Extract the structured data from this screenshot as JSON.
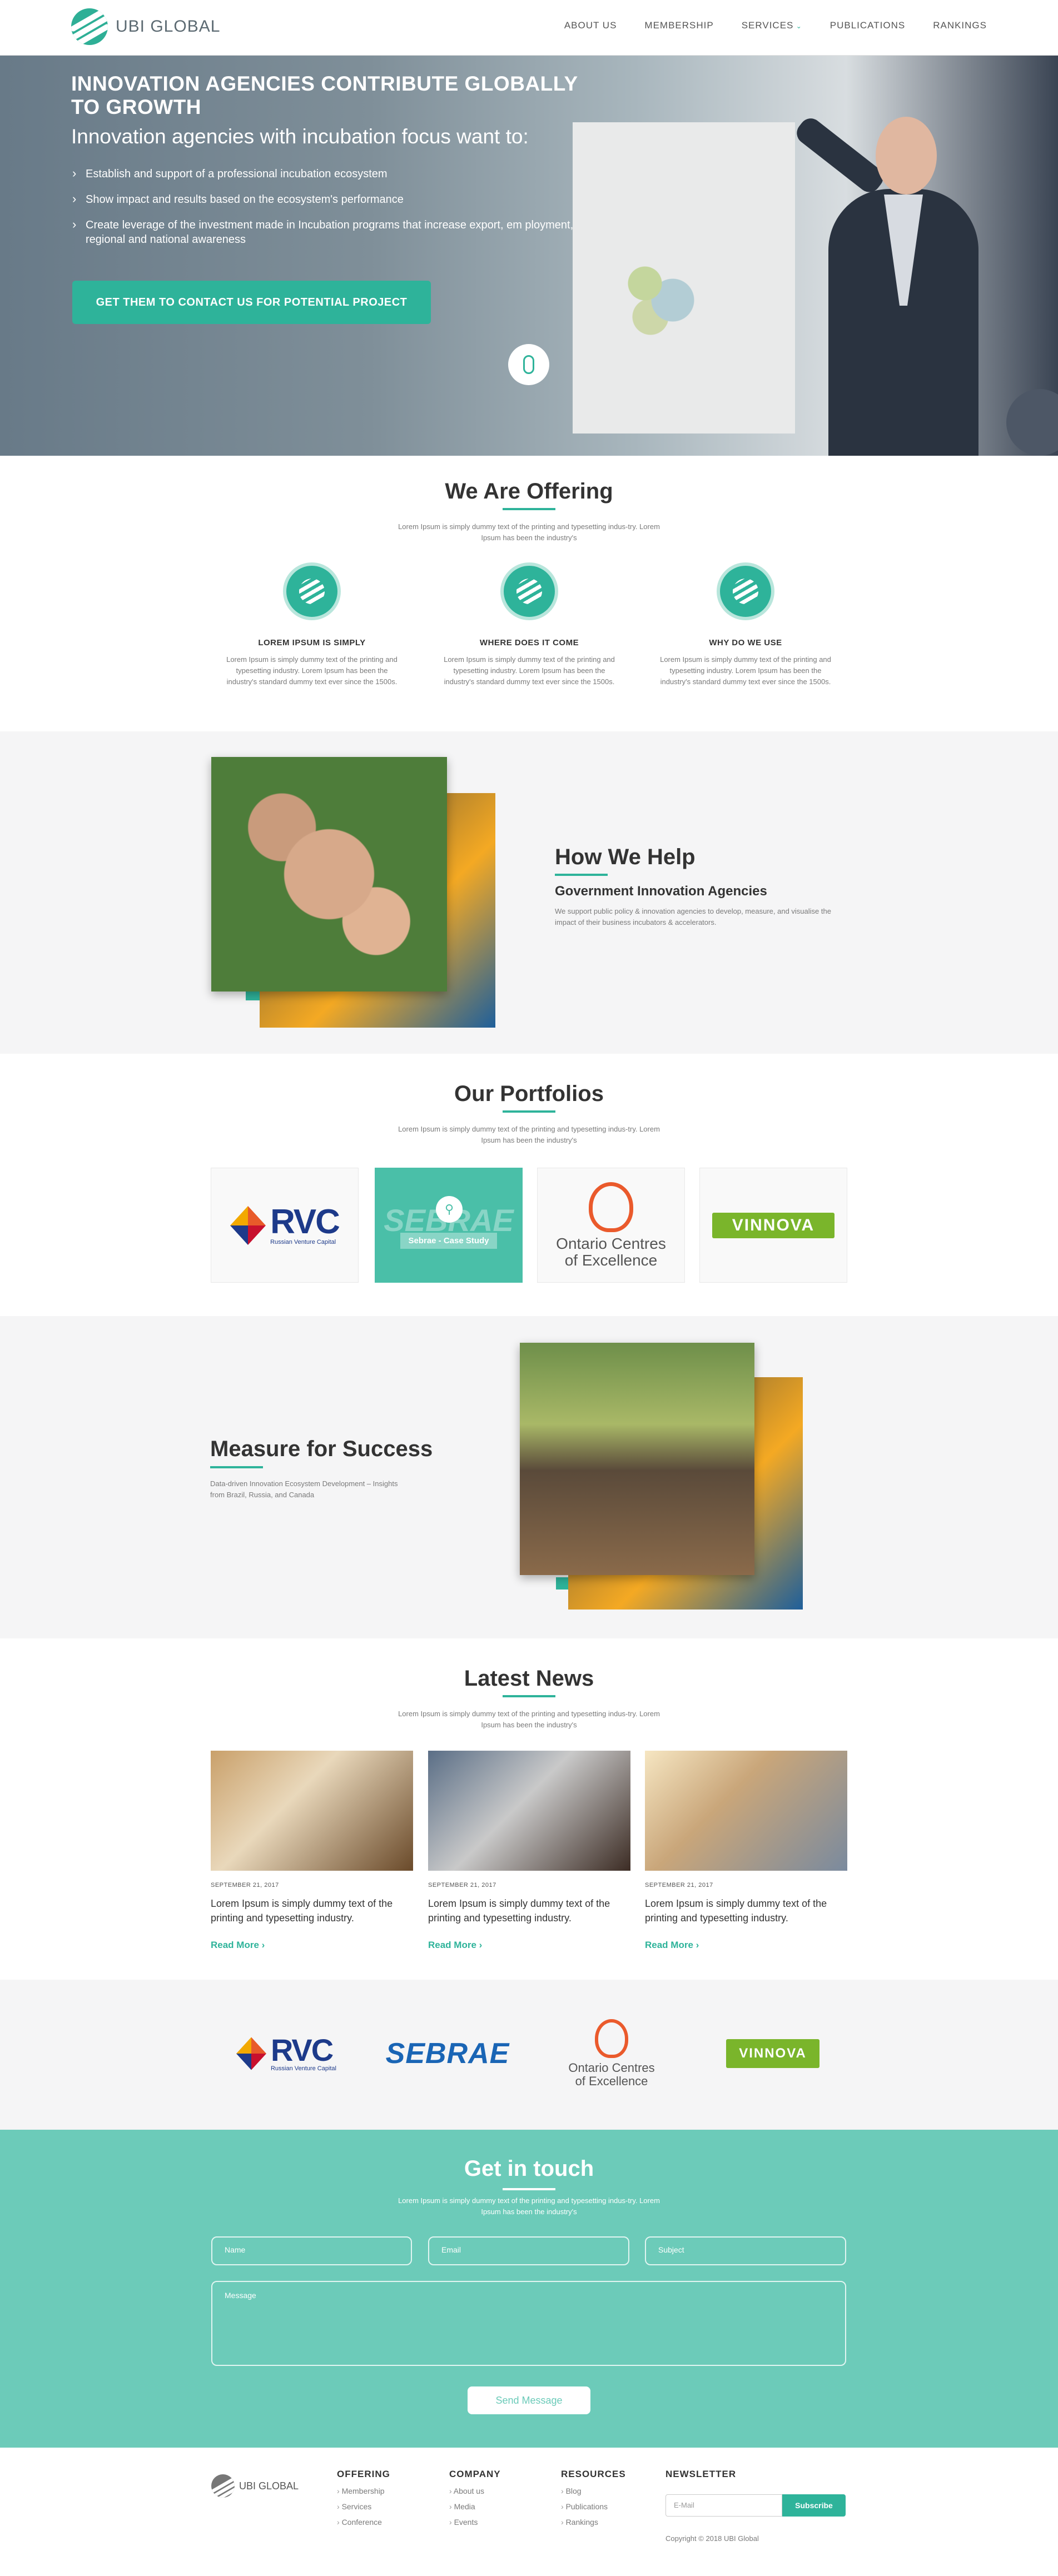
{
  "nav": {
    "logo_text": "UBI GLOBAL",
    "items": [
      "ABOUT US",
      "MEMBERSHIP",
      "SERVICES",
      "PUBLICATIONS",
      "RANKINGS"
    ]
  },
  "hero": {
    "title": "INNOVATION AGENCIES CONTRIBUTE GLOBALLY TO GROWTH",
    "subtitle": "Innovation agencies with incubation focus want to:",
    "bullets": [
      "Establish and support of a professional incubation ecosystem",
      "Show impact and results based on the ecosystem's performance",
      "Create leverage of the investment made in Incubation programs that increase export, em ployment, regional and national awareness"
    ],
    "cta": "GET THEM TO CONTACT US FOR POTENTIAL PROJECT"
  },
  "offering": {
    "title": "We Are Offering",
    "desc": "Lorem Ipsum is simply dummy text of the printing and typesetting indus-try. Lorem Ipsum has been the industry's",
    "cards": [
      {
        "title": "LOREM IPSUM IS SIMPLY",
        "text": "Lorem Ipsum is simply dummy text of the printing and typesetting industry. Lorem Ipsum has been the industry's standard dummy text ever since the 1500s."
      },
      {
        "title": "WHERE DOES IT COME",
        "text": "Lorem Ipsum is simply dummy text of the printing and typesetting industry. Lorem Ipsum has been the industry's standard dummy text ever since the 1500s."
      },
      {
        "title": "WHY DO WE USE",
        "text": "Lorem Ipsum is simply dummy text of the printing and typesetting industry. Lorem Ipsum has been the industry's standard dummy text ever since the 1500s."
      }
    ]
  },
  "help": {
    "title": "How We Help",
    "subtitle": "Government Innovation Agencies",
    "text": "We support public policy & innovation agencies to develop, measure, and visualise the impact of their business incubators & accelerators."
  },
  "portfolios": {
    "title": "Our Portfolios",
    "desc": "Lorem Ipsum is simply dummy text of the printing and typesetting indus-try. Lorem Ipsum has been the industry's",
    "rvc": {
      "text": "RVC",
      "caption": "Russian Venture Capital"
    },
    "sebrae": {
      "text": "SEBRAE",
      "caption": "Sebrae - Case Study"
    },
    "oce": {
      "line1": "Ontario Centres",
      "line2": "of Excellence"
    },
    "vinnova": "VINNOVA"
  },
  "measure": {
    "title": "Measure for Success",
    "text": "Data-driven Innovation Ecosystem Development – Insights from Brazil, Russia, and Canada"
  },
  "news": {
    "title": "Latest News",
    "desc": "Lorem Ipsum is simply dummy text of the printing and typesetting indus-try. Lorem Ipsum has been the industry's",
    "items": [
      {
        "date": "SEPTEMBER 21, 2017",
        "title": "Lorem Ipsum is simply dummy text of the printing and typesetting industry.",
        "more": "Read More ›"
      },
      {
        "date": "SEPTEMBER 21, 2017",
        "title": "Lorem Ipsum is simply dummy text of the printing and typesetting industry.",
        "more": "Read More ›"
      },
      {
        "date": "SEPTEMBER 21, 2017",
        "title": "Lorem Ipsum is simply dummy text of the printing and typesetting industry.",
        "more": "Read More ›"
      }
    ]
  },
  "partners": {
    "rvc": "RVC",
    "rvc_caption": "Russian Venture Capital",
    "sebrae": "SEBRAE",
    "oce_line1": "Ontario Centres",
    "oce_line2": "of Excellence",
    "vinnova": "VINNOVA"
  },
  "contact": {
    "title": "Get in touch",
    "desc": "Lorem Ipsum is simply dummy text of the printing and typesetting indus-try. Lorem Ipsum has been the industry's",
    "name_ph": "Name",
    "email_ph": "Email",
    "subject_ph": "Subject",
    "message_ph": "Message",
    "send": "Send Message"
  },
  "footer": {
    "logo_text": "UBI GLOBAL",
    "offering": {
      "title": "OFFERING",
      "items": [
        "Membership",
        "Services",
        "Conference"
      ]
    },
    "company": {
      "title": "COMPANY",
      "items": [
        "About us",
        "Media",
        "Events"
      ]
    },
    "resources": {
      "title": "RESOURCES",
      "items": [
        "Blog",
        "Publications",
        "Rankings"
      ]
    },
    "newsletter": {
      "title": "NEWSLETTER",
      "email_ph": "E-Mail",
      "subscribe": "Subscribe"
    },
    "copyright": "Copyright © 2018 UBI Global"
  },
  "colors": {
    "accent": "#2eb39a",
    "contact_bg": "#6ccbb9",
    "band": "#f5f5f6"
  }
}
